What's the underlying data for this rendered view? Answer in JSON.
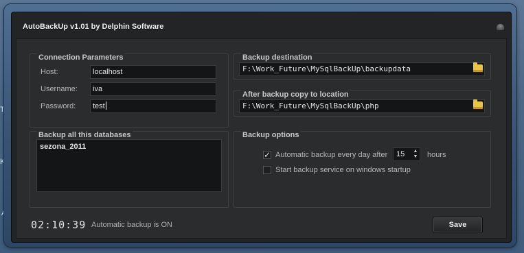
{
  "desktop": {
    "hint1": "Tr",
    "hint2": "Ko",
    "hint3": "A"
  },
  "window": {
    "title": "AutoBackUp v1.01 by Delphin Software"
  },
  "connection": {
    "group_title": "Connection Parameters",
    "host_label": "Host:",
    "host_value": "localhost",
    "username_label": "Username:",
    "username_value": "iva",
    "password_label": "Password:",
    "password_value": "test"
  },
  "destination": {
    "group_title": "Backup destination",
    "path": "F:\\Work_Future\\MySqlBackUp\\backupdata",
    "folder_icon": "folder-icon"
  },
  "copy_location": {
    "group_title": "After backup copy to location",
    "path": "F:\\Work_Future\\MySqlBackUp\\php",
    "folder_icon": "folder-icon"
  },
  "databases": {
    "group_title": "Backup all this databases",
    "items": [
      "sezona_2011"
    ]
  },
  "options": {
    "group_title": "Backup options",
    "auto_backup_label": "Automatic backup every day after",
    "auto_backup_checked": true,
    "hours_value": "15",
    "hours_unit": "hours",
    "startup_label": "Start backup service on windows startup",
    "startup_checked": false
  },
  "footer": {
    "clock": "02:10:39",
    "status": "Automatic backup is ON",
    "save_label": "Save"
  }
}
